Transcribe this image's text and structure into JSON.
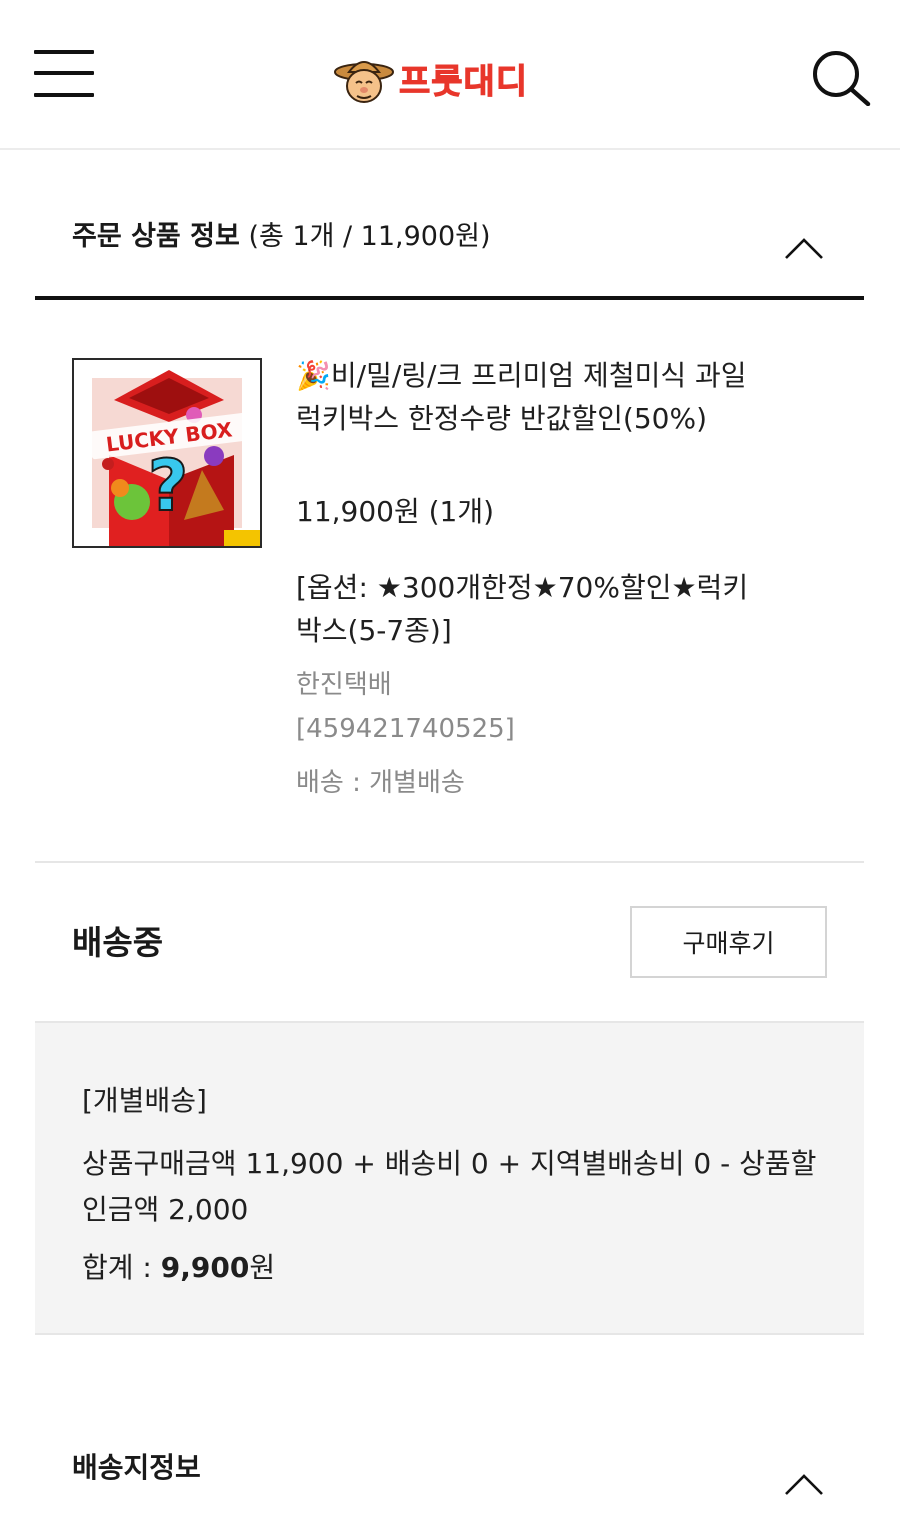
{
  "header": {
    "menu_icon": "hamburger-menu-icon",
    "logo_text": "프룻대디",
    "search_icon": "search-icon",
    "brand_color": "#e8362b"
  },
  "order_section": {
    "title": "주문 상품 정보",
    "summary": "(총 1개 / 11,900원)",
    "toggle_icon": "chevron-up-icon"
  },
  "product": {
    "thumbnail_text": "LUCKY BOX",
    "name_emoji": "🎉",
    "name": "비/밀/링/크 프리미엄 제철미식 과일 럭키박스 한정수량 반값할인(50%)",
    "price": "11,900원 (1개)",
    "option": "[옵션: ★300개한정★70%할인★럭키박스(5-7종)]",
    "courier": "한진택배",
    "tracking": "[459421740525]",
    "delivery": "배송 : 개별배송"
  },
  "status": {
    "label": "배송중",
    "review_button": "구매후기"
  },
  "delivery_summary": {
    "type": "[개별배송]",
    "calculation": "상품구매금액 11,900 + 배송비 0 + 지역별배송비 0 - 상품할인금액 2,000",
    "total_label": "합계 : ",
    "total_value": "9,900",
    "total_unit": "원"
  },
  "shipping_section": {
    "title": "배송지정보",
    "toggle_icon": "chevron-up-icon"
  }
}
